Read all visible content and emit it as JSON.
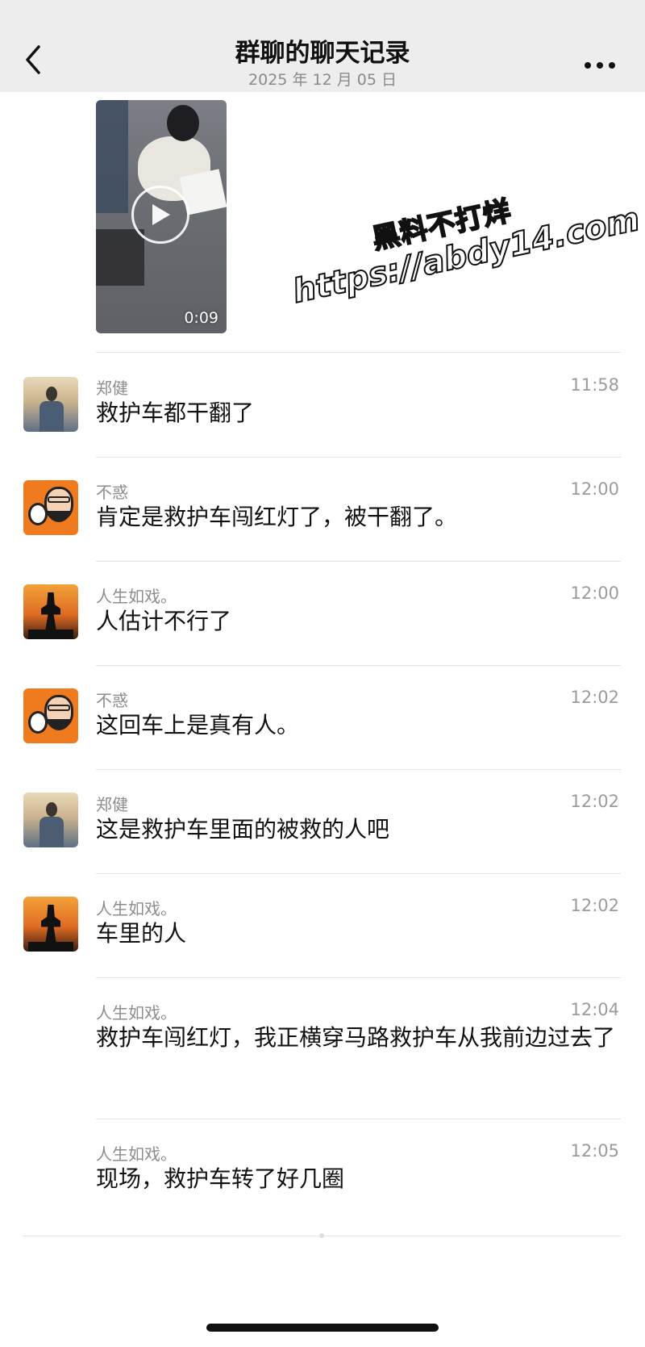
{
  "header": {
    "title": "群聊的聊天记录",
    "subtitle": "2025 年 12 月 05 日"
  },
  "video": {
    "duration": "0:09"
  },
  "watermark": {
    "line1": "黑料不打烊",
    "line2": "https://abdy14.com"
  },
  "messages": [
    {
      "sender": "郑健",
      "time": "11:58",
      "text": "救护车都干翻了",
      "avatar": "zheng-jian"
    },
    {
      "sender": "不惑",
      "time": "12:00",
      "text": "肯定是救护车闯红灯了，被干翻了。",
      "avatar": "bu-huo"
    },
    {
      "sender": "人生如戏。",
      "time": "12:00",
      "text": "人估计不行了",
      "avatar": "ren-sheng-ru-xi"
    },
    {
      "sender": "不惑",
      "time": "12:02",
      "text": "这回车上是真有人。",
      "avatar": "bu-huo"
    },
    {
      "sender": "郑健",
      "time": "12:02",
      "text": "这是救护车里面的被救的人吧",
      "avatar": "zheng-jian"
    },
    {
      "sender": "人生如戏。",
      "time": "12:02",
      "text": "车里的人",
      "avatar": "ren-sheng-ru-xi"
    },
    {
      "sender": "人生如戏。",
      "time": "12:04",
      "text": "救护车闯红灯，我正横穿马路救护车从我前边过去了",
      "avatar": ""
    },
    {
      "sender": "人生如戏。",
      "time": "12:05",
      "text": "现场，救护车转了好几圈",
      "avatar": ""
    }
  ],
  "colors": {
    "navbar_bg": "#ededed",
    "divider": "#e4e4e4",
    "meta_text": "#8c8c8c"
  },
  "icons": [
    "chevron-left-icon",
    "more-icon",
    "play-icon"
  ]
}
